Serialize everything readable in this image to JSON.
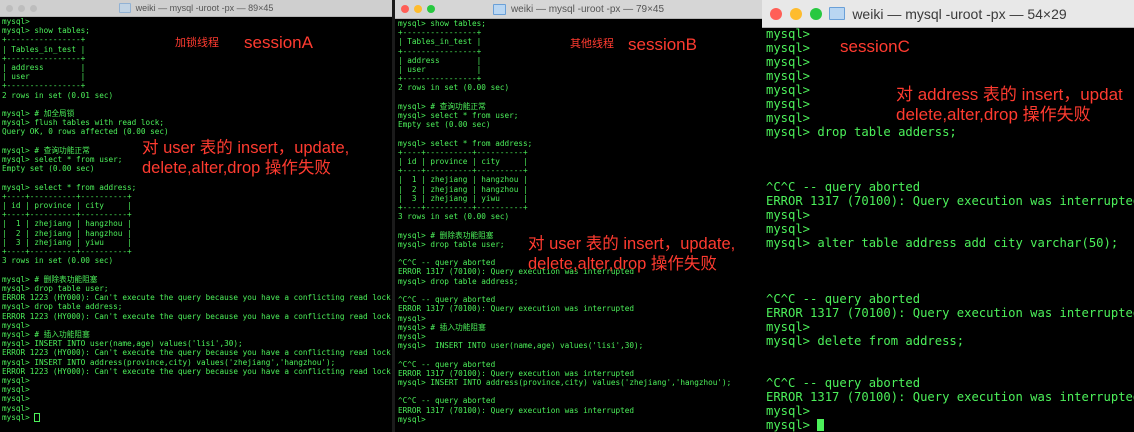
{
  "colors": {
    "terminal_bg": "#000000",
    "terminal_text": "#4cf05a",
    "annotation": "#ff3b30",
    "close": "#ff5f57",
    "minimize": "#febc2e",
    "zoom": "#28c840"
  },
  "windows": {
    "a": {
      "title": "weiki — mysql -uroot -px — 89×45",
      "label_cn": "加锁线程",
      "label_session": "sessionA",
      "annotation": "对 user 表的 insert，update,\ndelete,alter,drop 操作失败",
      "lines": [
        "mysql>",
        "mysql> show tables;",
        "+----------------+",
        "| Tables_in_test |",
        "+----------------+",
        "| address        |",
        "| user           |",
        "+----------------+",
        "2 rows in set (0.01 sec)",
        "",
        "mysql> # 加全局锁",
        "mysql> flush tables with read lock;",
        "Query OK, 0 rows affected (0.00 sec)",
        "",
        "mysql> # 查询功能正常",
        "mysql> select * from user;",
        "Empty set (0.00 sec)",
        "",
        "mysql> select * from address;",
        "+----+----------+----------+",
        "| id | province | city     |",
        "+----+----------+----------+",
        "|  1 | zhejiang | hangzhou |",
        "|  2 | zhejiang | hangzhou |",
        "|  3 | zhejiang | yiwu     |",
        "+----+----------+----------+",
        "3 rows in set (0.00 sec)",
        "",
        "mysql> # 删除表功能阻塞",
        "mysql> drop table user;",
        "ERROR 1223 (HY000): Can't execute the query because you have a conflicting read lock",
        "mysql> drop table address;",
        "ERROR 1223 (HY000): Can't execute the query because you have a conflicting read lock",
        "mysql>",
        "mysql> # 插入功能阻塞",
        "mysql> INSERT INTO user(name,age) values('lisi',30);",
        "ERROR 1223 (HY000): Can't execute the query because you have a conflicting read lock",
        "mysql> INSERT INTO address(province,city) values('zhejiang','hangzhou');",
        "ERROR 1223 (HY000): Can't execute the query because you have a conflicting read lock",
        "mysql>",
        "mysql>",
        "mysql>",
        "mysql>",
        "mysql> "
      ]
    },
    "b": {
      "title": "weiki — mysql -uroot -px — 79×45",
      "label_cn": "其他线程",
      "label_session": "sessionB",
      "annotation": "对 user 表的 insert，update,\ndelete,alter,drop 操作失败",
      "lines": [
        "mysql> show tables;",
        "+----------------+",
        "| Tables_in_test |",
        "+----------------+",
        "| address        |",
        "| user           |",
        "+----------------+",
        "2 rows in set (0.00 sec)",
        "",
        "mysql> # 查询功能正常",
        "mysql> select * from user;",
        "Empty set (0.00 sec)",
        "",
        "mysql> select * from address;",
        "+----+----------+----------+",
        "| id | province | city     |",
        "+----+----------+----------+",
        "|  1 | zhejiang | hangzhou |",
        "|  2 | zhejiang | hangzhou |",
        "|  3 | zhejiang | yiwu     |",
        "+----+----------+----------+",
        "3 rows in set (0.00 sec)",
        "",
        "mysql> # 删除表功能阻塞",
        "mysql> drop table user;",
        "",
        "^C^C -- query aborted",
        "ERROR 1317 (70100): Query execution was interrupted",
        "mysql> drop table address;",
        "",
        "^C^C -- query aborted",
        "ERROR 1317 (70100): Query execution was interrupted",
        "mysql>",
        "mysql> # 插入功能阻塞",
        "mysql>",
        "mysql>  INSERT INTO user(name,age) values('lisi',30);",
        "",
        "^C^C -- query aborted",
        "ERROR 1317 (70100): Query execution was interrupted",
        "mysql> INSERT INTO address(province,city) values('zhejiang','hangzhou');",
        "",
        "^C^C -- query aborted",
        "ERROR 1317 (70100): Query execution was interrupted",
        "mysql>"
      ]
    },
    "c": {
      "title": "weiki — mysql -uroot -px — 54×29",
      "label_session": "sessionC",
      "annotation": "对 address 表的 insert，updat\ndelete,alter,drop 操作失败",
      "lines": [
        "mysql>",
        "mysql>",
        "mysql>",
        "mysql>",
        "mysql>",
        "mysql>",
        "mysql>",
        "mysql> drop table adderss;",
        "",
        "",
        "",
        "^C^C -- query aborted",
        "ERROR 1317 (70100): Query execution was interrupted",
        "mysql>",
        "mysql>",
        "mysql> alter table address add city varchar(50);",
        "",
        "",
        "",
        "^C^C -- query aborted",
        "ERROR 1317 (70100): Query execution was interrupted",
        "mysql>",
        "mysql> delete from address;",
        "",
        "",
        "^C^C -- query aborted",
        "ERROR 1317 (70100): Query execution was interrupted",
        "mysql>",
        "mysql> "
      ]
    }
  }
}
